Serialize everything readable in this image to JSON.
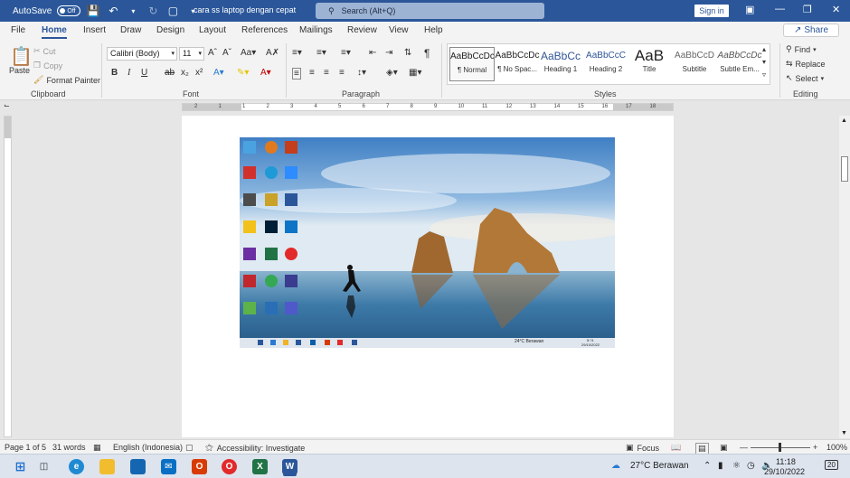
{
  "titlebar": {
    "autosave_label": "AutoSave",
    "autosave_state": "Off",
    "doc_title": "cara ss laptop dengan cepat",
    "search_placeholder": "Search (Alt+Q)",
    "signin_label": "Sign in"
  },
  "menu": {
    "tabs": [
      "File",
      "Home",
      "Insert",
      "Draw",
      "Design",
      "Layout",
      "References",
      "Mailings",
      "Review",
      "View",
      "Help"
    ],
    "active": "Home",
    "share_label": "Share"
  },
  "ribbon": {
    "clipboard": {
      "paste": "Paste",
      "cut": "Cut",
      "copy": "Copy",
      "format_painter": "Format Painter",
      "label": "Clipboard"
    },
    "font": {
      "font_name": "Calibri (Body)",
      "font_size": "11",
      "label": "Font"
    },
    "paragraph": {
      "label": "Paragraph"
    },
    "styles": {
      "label": "Styles",
      "items": [
        {
          "preview": "AaBbCcDc",
          "name": "¶ Normal"
        },
        {
          "preview": "AaBbCcDc",
          "name": "¶ No Spac..."
        },
        {
          "preview": "AaBbCc",
          "name": "Heading 1"
        },
        {
          "preview": "AaBbCcC",
          "name": "Heading 2"
        },
        {
          "preview": "AaB",
          "name": "Title"
        },
        {
          "preview": "AaBbCcD",
          "name": "Subtitle"
        },
        {
          "preview": "AaBbCcDc",
          "name": "Subtle Em..."
        }
      ]
    },
    "editing": {
      "find": "Find",
      "replace": "Replace",
      "select": "Select",
      "label": "Editing"
    }
  },
  "ruler_marks": [
    "2",
    "1",
    "1",
    "2",
    "3",
    "4",
    "5",
    "6",
    "7",
    "8",
    "9",
    "10",
    "11",
    "12",
    "13",
    "14",
    "15",
    "16",
    "17",
    "18"
  ],
  "statusbar": {
    "page": "Page 1 of 5",
    "words": "31 words",
    "language": "English (Indonesia)",
    "accessibility": "Accessibility: Investigate",
    "focus": "Focus",
    "zoom": "100%"
  },
  "desktop_image": {
    "weather": "24°C Berawan",
    "time": "5:?1",
    "date": "29/10/2022"
  },
  "taskbar": {
    "weather": "27°C Berawan",
    "time": "11:18",
    "date": "29/10/2022",
    "notif_count": "20"
  },
  "colors": {
    "word_blue": "#2b579a",
    "ribbon_bg": "#f3f3f3"
  }
}
